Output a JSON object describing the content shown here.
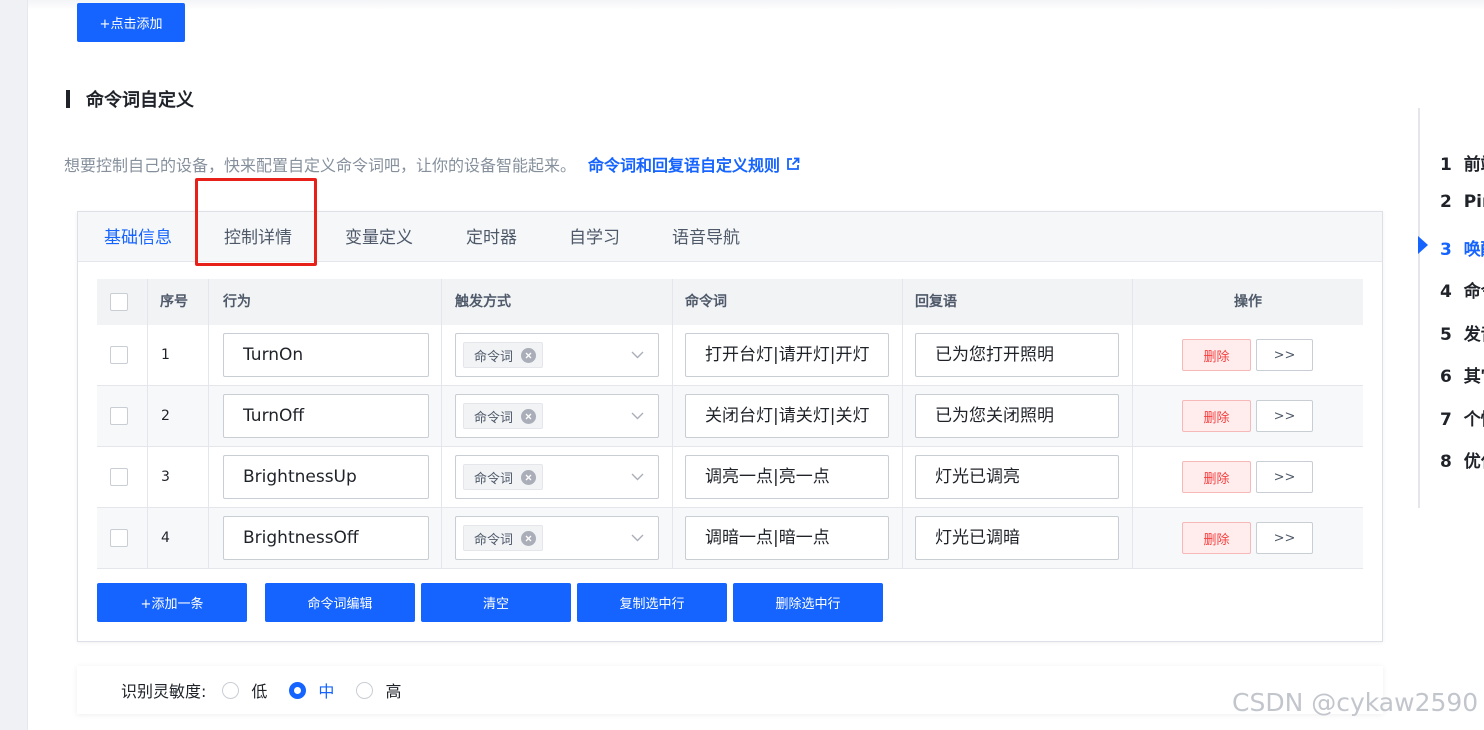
{
  "top_button": {
    "label": "+点击添加"
  },
  "section": {
    "title": "命令词自定义",
    "description": "想要控制自己的设备，快来配置自定义命令词吧，让你的设备智能起来。",
    "rule_link": "命令词和回复语自定义规则"
  },
  "tabs": [
    "基础信息",
    "控制详情",
    "变量定义",
    "定时器",
    "自学习",
    "语音导航"
  ],
  "table": {
    "headers": {
      "index": "序号",
      "action": "行为",
      "trigger": "触发方式",
      "command": "命令词",
      "reply": "回复语",
      "ops": "操作"
    },
    "rows": [
      {
        "index": "1",
        "action": "TurnOn",
        "trigger": "命令词",
        "command": "打开台灯|请开灯|开灯",
        "reply": "已为您打开照明"
      },
      {
        "index": "2",
        "action": "TurnOff",
        "trigger": "命令词",
        "command": "关闭台灯|请关灯|关灯",
        "reply": "已为您关闭照明"
      },
      {
        "index": "3",
        "action": "BrightnessUp",
        "trigger": "命令词",
        "command": "调亮一点|亮一点",
        "reply": "灯光已调亮"
      },
      {
        "index": "4",
        "action": "BrightnessOff",
        "trigger": "命令词",
        "command": "调暗一点|暗一点",
        "reply": "灯光已调暗"
      }
    ],
    "delete_label": "删除",
    "more_label": ">>"
  },
  "actions": {
    "add": "+添加一条",
    "edit": "命令词编辑",
    "clear": "清空",
    "copy": "复制选中行",
    "delete": "删除选中行"
  },
  "sensitivity": {
    "label": "识别灵敏度:",
    "options": [
      "低",
      "中",
      "高"
    ],
    "selected": "中"
  },
  "toc": [
    {
      "num": "1",
      "text": "前端"
    },
    {
      "num": "2",
      "text": "Pin"
    },
    {
      "num": "3",
      "text": "唤醒"
    },
    {
      "num": "4",
      "text": "命令"
    },
    {
      "num": "5",
      "text": "发音"
    },
    {
      "num": "6",
      "text": "其它"
    },
    {
      "num": "7",
      "text": "个性"
    },
    {
      "num": "8",
      "text": "优化"
    }
  ],
  "watermark": "CSDN @cykaw2590",
  "colors": {
    "primary": "#1664ff",
    "danger": "#f53f3f",
    "highlight": "#e8201a"
  }
}
